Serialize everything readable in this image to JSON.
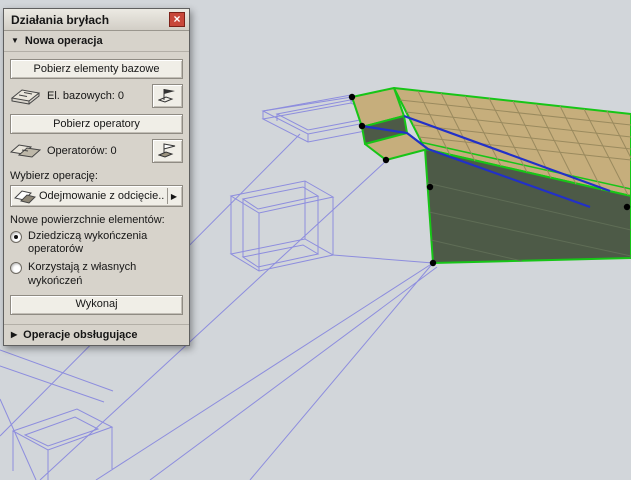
{
  "icons": {
    "close": "×",
    "expanded": "▼",
    "collapsed": "▶",
    "dropdown_arrow": "▶"
  },
  "dialog": {
    "title": "Działania bryłach",
    "new_operation_section": "Nowa operacja",
    "get_base_elements_button": "Pobierz elementy bazowe",
    "base_elements": {
      "label": "El. bazowych:",
      "count": "0"
    },
    "get_operators_button": "Pobierz operatory",
    "operators": {
      "label": "Operatorów:",
      "count": "0"
    },
    "choose_operation_label": "Wybierz operację:",
    "operation_dropdown_value": "Odejmowanie z odcięcie...",
    "new_surfaces_label": "Nowe powierzchnie elementów:",
    "radio_inherit": "Dziedziczą wykończenia operatorów",
    "radio_own": "Korzystają z własnych wykończeń",
    "execute_button": "Wykonaj",
    "supporting_operations_section": "Operacje obsługujące"
  },
  "viewport": {
    "colors": {
      "background": "#d2d6da",
      "wireframe": "#8d8dde",
      "selection_green": "#17c517",
      "operator_blue": "#2230c8",
      "slab_top": "#c6ae7c",
      "slab_grid": "#9a8a5e",
      "slab_side": "#4d5a47",
      "handle_black": "#000000"
    }
  }
}
